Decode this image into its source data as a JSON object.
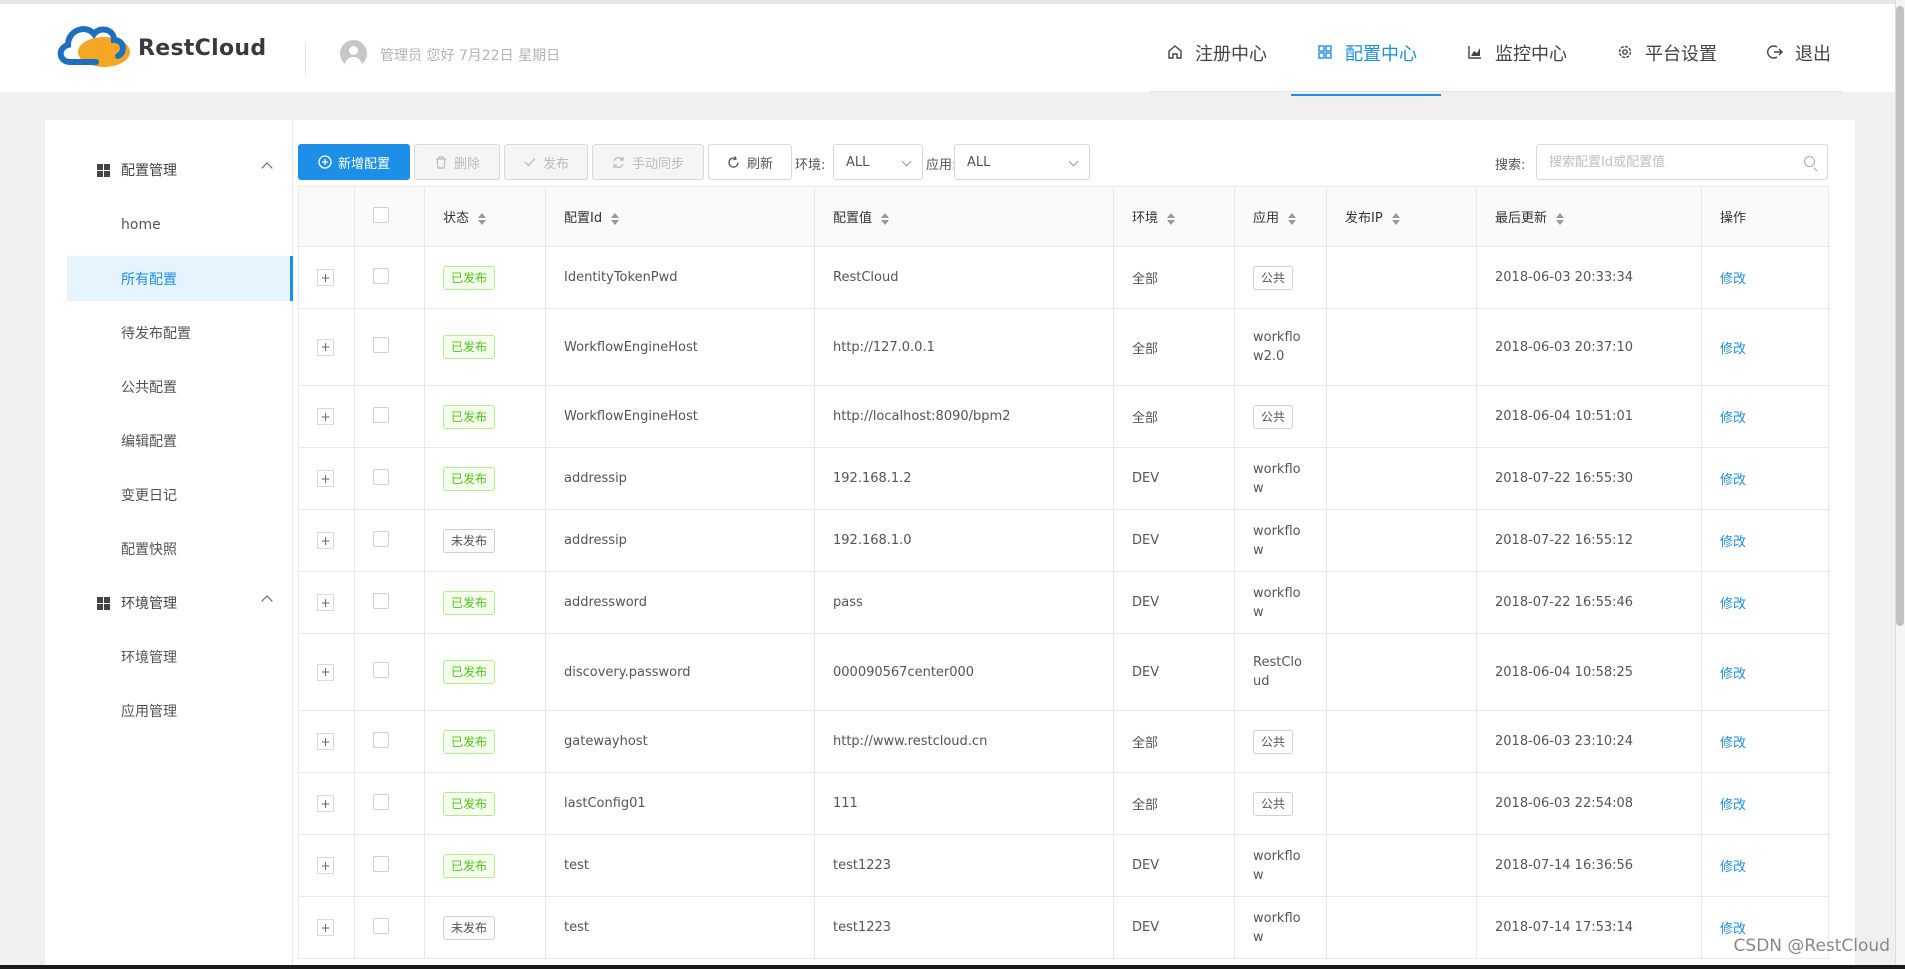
{
  "brand": {
    "name": "RestCloud"
  },
  "header": {
    "greeting": "管理员 您好 7月22日 星期日"
  },
  "nav": [
    {
      "label": "注册中心",
      "icon": "home-icon",
      "active": false
    },
    {
      "label": "配置中心",
      "icon": "grid-icon",
      "active": true
    },
    {
      "label": "监控中心",
      "icon": "bar-chart-icon",
      "active": false
    },
    {
      "label": "平台设置",
      "icon": "gear-icon",
      "active": false
    },
    {
      "label": "退出",
      "icon": "logout-icon",
      "active": false
    }
  ],
  "sidebar": {
    "groups": [
      {
        "label": "配置管理",
        "items": [
          "home",
          "所有配置",
          "待发布配置",
          "公共配置",
          "编辑配置",
          "变更日记",
          "配置快照"
        ]
      },
      {
        "label": "环境管理",
        "items": [
          "环境管理",
          "应用管理"
        ]
      }
    ],
    "active_item": "所有配置"
  },
  "toolbar": {
    "add_label": "新增配置",
    "delete_label": "删除",
    "publish_label": "发布",
    "sync_label": "手动同步",
    "refresh_label": "刷新",
    "env_label": "环境:",
    "env_value": "ALL",
    "app_label": "应用:",
    "app_value": "ALL",
    "search_label": "搜索:",
    "search_placeholder": "搜索配置Id或配置值"
  },
  "table": {
    "columns": [
      "状态",
      "配置Id",
      "配置值",
      "环境",
      "应用",
      "发布IP",
      "最后更新",
      "操作"
    ],
    "rows": [
      {
        "status": "已发布",
        "status_type": "pub",
        "id": "IdentityTokenPwd",
        "value": "RestCloud",
        "env": "全部",
        "app": "公共",
        "app_tag": true,
        "ip": "",
        "updated": "2018-06-03 20:33:34",
        "action": "修改"
      },
      {
        "status": "已发布",
        "status_type": "pub",
        "id": "WorkflowEngineHost",
        "value": "http://127.0.0.1",
        "env": "全部",
        "app": "workflow2.0",
        "app_tag": false,
        "ip": "",
        "updated": "2018-06-03 20:37:10",
        "action": "修改"
      },
      {
        "status": "已发布",
        "status_type": "pub",
        "id": "WorkflowEngineHost",
        "value": "http://localhost:8090/bpm2",
        "env": "全部",
        "app": "公共",
        "app_tag": true,
        "ip": "",
        "updated": "2018-06-04 10:51:01",
        "action": "修改"
      },
      {
        "status": "已发布",
        "status_type": "pub",
        "id": "addressip",
        "value": "192.168.1.2",
        "env": "DEV",
        "app": "workflow",
        "app_tag": false,
        "ip": "",
        "updated": "2018-07-22 16:55:30",
        "action": "修改"
      },
      {
        "status": "未发布",
        "status_type": "unpub",
        "id": "addressip",
        "value": "192.168.1.0",
        "env": "DEV",
        "app": "workflow",
        "app_tag": false,
        "ip": "",
        "updated": "2018-07-22 16:55:12",
        "action": "修改"
      },
      {
        "status": "已发布",
        "status_type": "pub",
        "id": "addressword",
        "value": "pass",
        "env": "DEV",
        "app": "workflow",
        "app_tag": false,
        "ip": "",
        "updated": "2018-07-22 16:55:46",
        "action": "修改"
      },
      {
        "status": "已发布",
        "status_type": "pub",
        "id": "discovery.password",
        "value": "000090567center000",
        "env": "DEV",
        "app": "RestCloud",
        "app_tag": false,
        "ip": "",
        "updated": "2018-06-04 10:58:25",
        "action": "修改"
      },
      {
        "status": "已发布",
        "status_type": "pub",
        "id": "gatewayhost",
        "value": "http://www.restcloud.cn",
        "env": "全部",
        "app": "公共",
        "app_tag": true,
        "ip": "",
        "updated": "2018-06-03 23:10:24",
        "action": "修改"
      },
      {
        "status": "已发布",
        "status_type": "pub",
        "id": "lastConfig01",
        "value": "111",
        "env": "全部",
        "app": "公共",
        "app_tag": true,
        "ip": "",
        "updated": "2018-06-03 22:54:08",
        "action": "修改"
      },
      {
        "status": "已发布",
        "status_type": "pub",
        "id": "test",
        "value": "test1223",
        "env": "DEV",
        "app": "workflow",
        "app_tag": false,
        "ip": "",
        "updated": "2018-07-14 16:36:56",
        "action": "修改"
      },
      {
        "status": "未发布",
        "status_type": "unpub",
        "id": "test",
        "value": "test1223",
        "env": "DEV",
        "app": "workflow",
        "app_tag": false,
        "ip": "",
        "updated": "2018-07-14 17:53:14",
        "action": "修改"
      }
    ]
  },
  "watermark": "CSDN @RestCloud",
  "colors": {
    "accent": "#1e8fe6",
    "published": "#52c41a",
    "logo_blue": "#1f6fbf",
    "logo_orange": "#f5a623"
  }
}
